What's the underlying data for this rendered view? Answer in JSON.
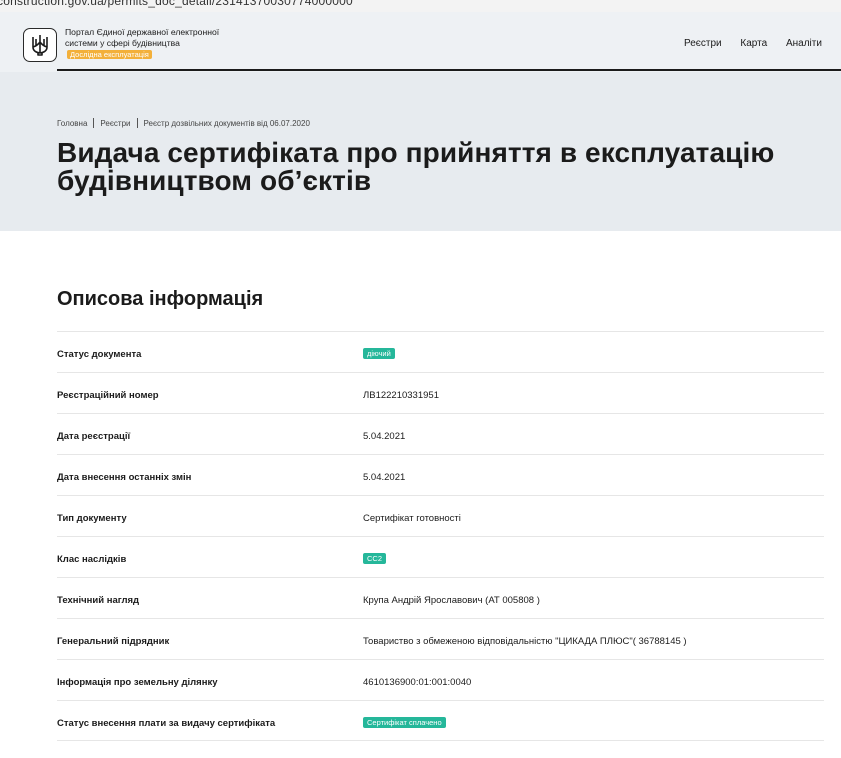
{
  "browser": {
    "url": "construction.gov.ua/permits_doc_detail/23141370030774000000"
  },
  "header": {
    "portal_title": "Портал Єдиної державної електронної системи у сфері будівництва",
    "beta_badge": "Дослідна експлуатація",
    "nav": [
      "Реєстри",
      "Карта",
      "Аналіти"
    ]
  },
  "breadcrumb": [
    "Головна",
    "Реєстри",
    "Реєстр дозвільних документів від 06.07.2020"
  ],
  "page_title": "Видача сертифіката про прийняття в експлуатацію\nбудівництвом об’єктів",
  "section_title": "Описова інформація",
  "info_rows": [
    {
      "label": "Статус документа",
      "value": "діючий",
      "type": "tag"
    },
    {
      "label": "Реєстраційний номер",
      "value": "ЛВ122210331951",
      "type": "text"
    },
    {
      "label": "Дата реєстрації",
      "value": "5.04.2021",
      "type": "text"
    },
    {
      "label": "Дата внесення останніх змін",
      "value": "5.04.2021",
      "type": "text"
    },
    {
      "label": "Тип документу",
      "value": "Сертифікат готовності",
      "type": "text"
    },
    {
      "label": "Клас наслідків",
      "value": "СС2",
      "type": "tag"
    },
    {
      "label": "Технічний нагляд",
      "value": "Крупа Андрій Ярославович (АТ 005808 )",
      "type": "text"
    },
    {
      "label": "Генеральний підрядник",
      "value": "Товариство з обмеженою відповідальністю \"ЦИКАДА ПЛЮС\"( 36788145 )",
      "type": "text"
    },
    {
      "label": "Інформація про земельну ділянку",
      "value": "4610136900:01:001:0040",
      "type": "text"
    },
    {
      "label": "Статус внесення плати за видачу сертифіката",
      "value": "Сертифікат сплачено",
      "type": "tag"
    }
  ],
  "colors": {
    "tag": "#25b79a",
    "beta_badge": "#f3b03a",
    "hero_bg": "#e7ebef"
  },
  "icons": {
    "logo": "trident-icon"
  }
}
